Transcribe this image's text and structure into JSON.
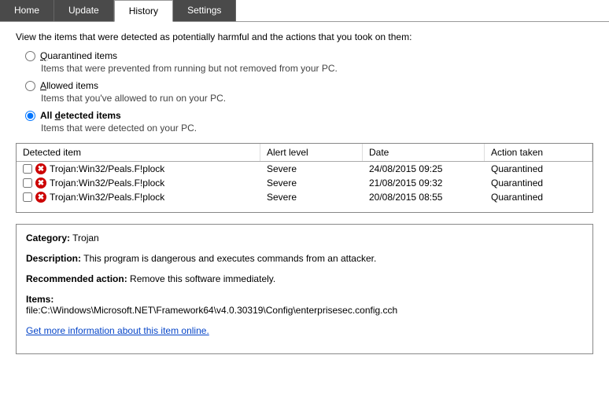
{
  "tabs": {
    "home": "Home",
    "update": "Update",
    "history": "History",
    "settings": "Settings"
  },
  "intro": "View the items that were detected as potentially harmful and the actions that you took on them:",
  "options": {
    "quarantined": {
      "label_pre": "Q",
      "label_post": "uarantined items",
      "desc": "Items that were prevented from running but not removed from your PC."
    },
    "allowed": {
      "label_pre": "A",
      "label_post": "llowed items",
      "desc": "Items that you've allowed to run on your PC."
    },
    "all": {
      "label_pre": "All ",
      "label_u": "d",
      "label_post": "etected items",
      "desc": "Items that were detected on your PC."
    }
  },
  "table": {
    "headers": {
      "item": "Detected item",
      "alert": "Alert level",
      "date": "Date",
      "action": "Action taken"
    },
    "rows": [
      {
        "name": "Trojan:Win32/Peals.F!plock",
        "alert": "Severe",
        "date": "24/08/2015 09:25",
        "action": "Quarantined"
      },
      {
        "name": "Trojan:Win32/Peals.F!plock",
        "alert": "Severe",
        "date": "21/08/2015 09:32",
        "action": "Quarantined"
      },
      {
        "name": "Trojan:Win32/Peals.F!plock",
        "alert": "Severe",
        "date": "20/08/2015 08:55",
        "action": "Quarantined"
      }
    ]
  },
  "details": {
    "category_label": "Category:",
    "category_value": "Trojan",
    "description_label": "Description:",
    "description_value": "This program is dangerous and executes commands from an attacker.",
    "recommended_label": "Recommended action:",
    "recommended_value": "Remove this software immediately.",
    "items_label": "Items:",
    "items_value": "file:C:\\Windows\\Microsoft.NET\\Framework64\\v4.0.30319\\Config\\enterprisesec.config.cch",
    "link": "Get more information about this item online."
  }
}
